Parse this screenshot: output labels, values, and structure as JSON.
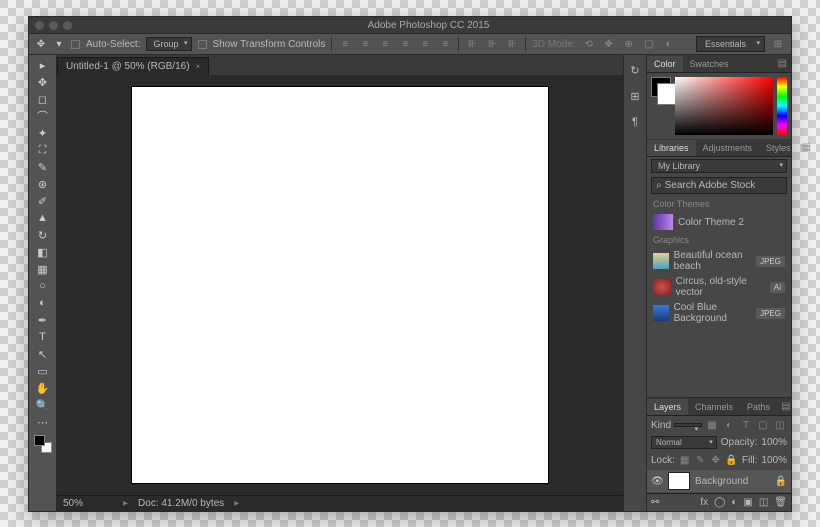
{
  "titlebar": {
    "title": "Adobe Photoshop CC 2015"
  },
  "options": {
    "auto_select_label": "Auto-Select:",
    "auto_select_value": "Group",
    "show_transform_label": "Show Transform Controls",
    "mode3d_label": "3D Mode:",
    "workspace": "Essentials"
  },
  "document": {
    "tab_label": "Untitled-1 @ 50% (RGB/16)",
    "zoom": "50%",
    "doc_info": "Doc: 41.2M/0 bytes"
  },
  "panels": {
    "color_tab": "Color",
    "swatches_tab": "Swatches",
    "libraries_tab": "Libraries",
    "adjustments_tab": "Adjustments",
    "styles_tab": "Styles",
    "layers_tab": "Layers",
    "channels_tab": "Channels",
    "paths_tab": "Paths"
  },
  "libraries": {
    "selected": "My Library",
    "search_placeholder": "Search Adobe Stock",
    "group_colors": "Color Themes",
    "asset_theme": "Color Theme 2",
    "group_graphics": "Graphics",
    "assets": [
      {
        "name": "Beautiful ocean beach",
        "badge": "JPEG"
      },
      {
        "name": "Circus, old-style vector",
        "badge": "Ai"
      },
      {
        "name": "Cool Blue Background",
        "badge": "JPEG"
      }
    ]
  },
  "layers": {
    "kind_label": "Kind",
    "blend": "Normal",
    "opacity_label": "Opacity:",
    "opacity_value": "100%",
    "lock_label": "Lock:",
    "fill_label": "Fill:",
    "fill_value": "100%",
    "bg_name": "Background"
  }
}
